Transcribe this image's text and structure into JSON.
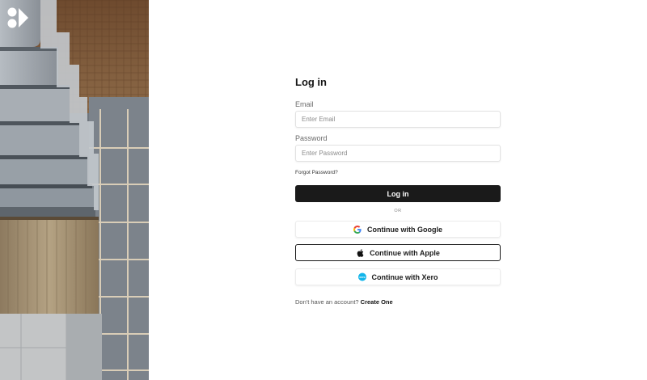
{
  "brand": {
    "logo_icon": "brand-logo-icon"
  },
  "login": {
    "title": "Log in",
    "email_label": "Email",
    "email_placeholder": "Enter Email",
    "email_value": "",
    "password_label": "Password",
    "password_placeholder": "Enter Password",
    "password_value": "",
    "forgot_link": "Forgot Password?",
    "submit_label": "Log in",
    "divider": "OR",
    "providers": {
      "google": {
        "label": "Continue with Google",
        "icon": "google-icon"
      },
      "apple": {
        "label": "Continue with Apple",
        "icon": "apple-icon"
      },
      "xero": {
        "label": "Continue with Xero",
        "icon": "xero-icon",
        "icon_text": "xero"
      }
    },
    "signup_prompt": "Don't have an account?",
    "signup_link": "Create One"
  },
  "colors": {
    "primary_button": "#1a1a1a",
    "xero_brand": "#13b5ea",
    "page_background": "#ffffff"
  }
}
